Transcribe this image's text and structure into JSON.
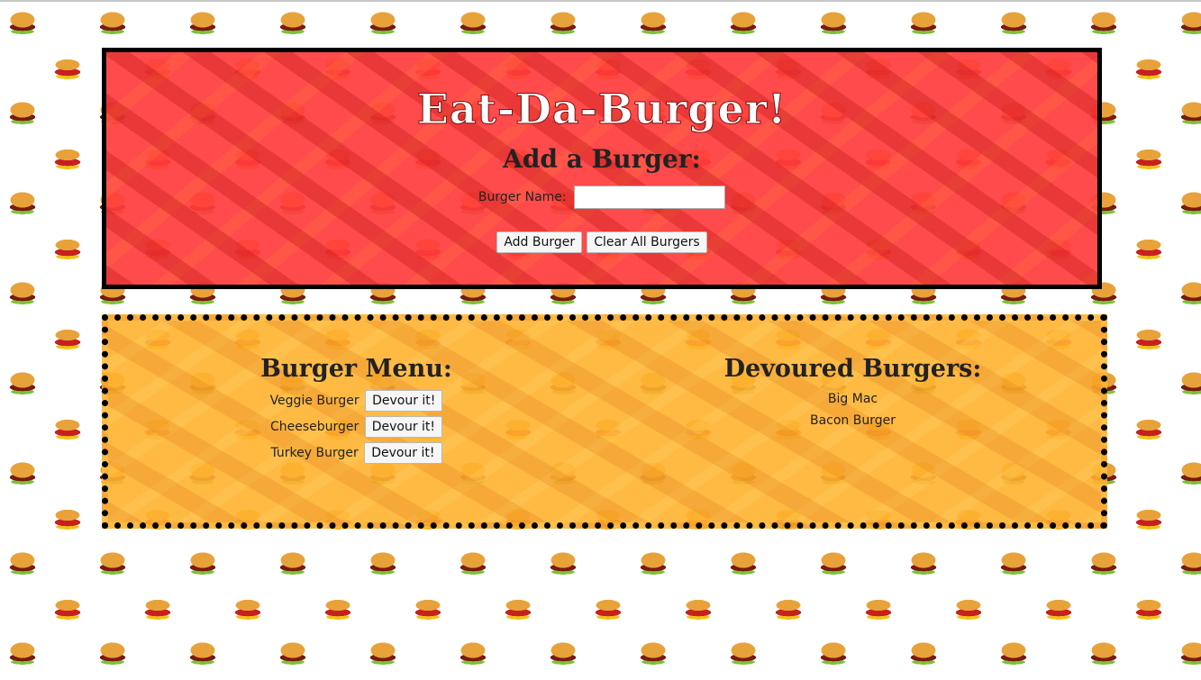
{
  "header": {
    "title": "Eat-Da-Burger!",
    "add_heading": "Add a Burger:",
    "name_label": "Burger Name:",
    "name_value": "",
    "add_button": "Add Burger",
    "clear_button": "Clear All Burgers"
  },
  "menu": {
    "heading": "Burger Menu:",
    "devour_label": "Devour it!",
    "items": [
      {
        "name": "Veggie Burger"
      },
      {
        "name": "Cheeseburger"
      },
      {
        "name": "Turkey Burger"
      }
    ]
  },
  "devoured": {
    "heading": "Devoured Burgers:",
    "items": [
      {
        "name": "Big Mac"
      },
      {
        "name": "Bacon Burger"
      }
    ]
  },
  "colors": {
    "add_panel": "#ff3c3c",
    "menu_panel": "#ffb230",
    "title_text": "#ffffff"
  }
}
